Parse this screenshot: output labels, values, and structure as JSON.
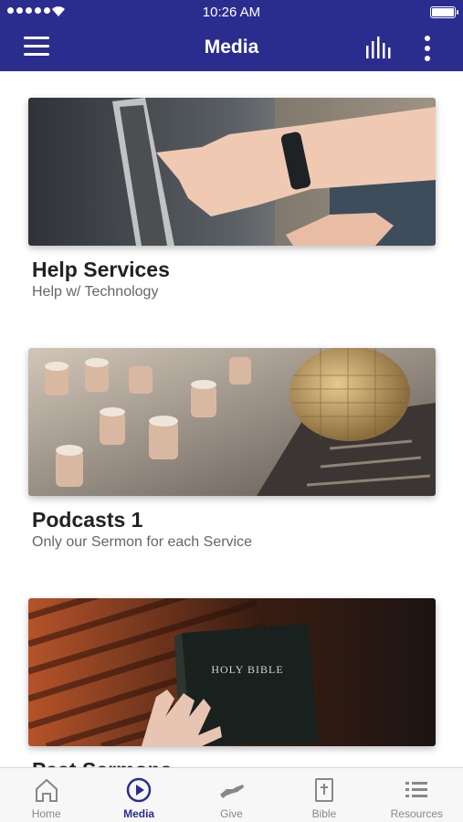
{
  "status_bar": {
    "time": "10:26 AM"
  },
  "app_bar": {
    "title": "Media"
  },
  "cards": [
    {
      "title": "Help Services",
      "subtitle": "Help w/ Technology",
      "image": "hands-pointing-tablet"
    },
    {
      "title": "Podcasts 1",
      "subtitle": "Only our Sermon for each Service",
      "image": "microphone-mixer"
    },
    {
      "title": "Past Sermons",
      "subtitle": "",
      "image": "holy-bible",
      "image_text": "HOLY BIBLE"
    }
  ],
  "tabs": [
    {
      "label": "Home",
      "icon": "home-icon",
      "active": false
    },
    {
      "label": "Media",
      "icon": "play-circle-icon",
      "active": true
    },
    {
      "label": "Give",
      "icon": "give-hand-icon",
      "active": false
    },
    {
      "label": "Bible",
      "icon": "bible-book-icon",
      "active": false
    },
    {
      "label": "Resources",
      "icon": "list-icon",
      "active": false
    }
  ],
  "colors": {
    "primary": "#2b2d8e",
    "inactive": "#888888"
  }
}
